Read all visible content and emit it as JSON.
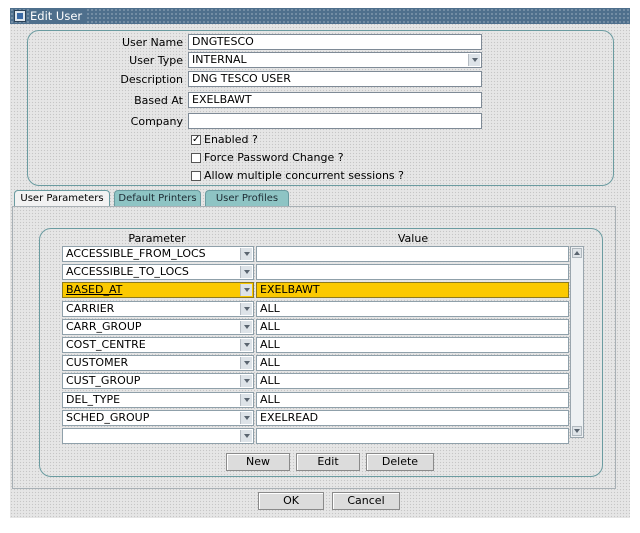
{
  "window": {
    "title": "Edit User",
    "icon": "app-window-icon"
  },
  "form": {
    "user_name": {
      "label": "User Name",
      "value": "DNGTESCO"
    },
    "user_type": {
      "label": "User Type",
      "value": "INTERNAL"
    },
    "description": {
      "label": "Description",
      "value": "DNG TESCO USER"
    },
    "based_at": {
      "label": "Based At",
      "value": "EXELBAWT"
    },
    "company": {
      "label": "Company",
      "value": ""
    },
    "enabled": {
      "label": "Enabled ?",
      "checked": true
    },
    "force_password": {
      "label": "Force Password Change ?",
      "checked": false
    },
    "concurrent": {
      "label": "Allow multiple concurrent sessions ?",
      "checked": false
    }
  },
  "tabs": [
    {
      "label": "User Parameters",
      "active": true
    },
    {
      "label": "Default Printers",
      "active": false
    },
    {
      "label": "User Profiles",
      "active": false
    }
  ],
  "grid": {
    "headers": {
      "parameter": "Parameter",
      "value": "Value"
    },
    "rows": [
      {
        "parameter": "ACCESSIBLE_FROM_LOCS",
        "value": ""
      },
      {
        "parameter": "ACCESSIBLE_TO_LOCS",
        "value": ""
      },
      {
        "parameter": "BASED_AT",
        "value": "EXELBAWT",
        "selected": true
      },
      {
        "parameter": "CARRIER",
        "value": "ALL"
      },
      {
        "parameter": "CARR_GROUP",
        "value": "ALL"
      },
      {
        "parameter": "COST_CENTRE",
        "value": "ALL"
      },
      {
        "parameter": "CUSTOMER",
        "value": "ALL"
      },
      {
        "parameter": "CUST_GROUP",
        "value": "ALL"
      },
      {
        "parameter": "DEL_TYPE",
        "value": "ALL"
      },
      {
        "parameter": "SCHED_GROUP",
        "value": "EXELREAD"
      },
      {
        "parameter": "",
        "value": ""
      }
    ],
    "buttons": {
      "new": "New",
      "edit": "Edit",
      "delete": "Delete"
    }
  },
  "footer": {
    "ok": "OK",
    "cancel": "Cancel"
  },
  "colors": {
    "selected_row": "#fbc900",
    "group_border": "#6a9ba0",
    "inactive_tab": "#8ec4c4",
    "title_bar": "#4e6f8c"
  }
}
